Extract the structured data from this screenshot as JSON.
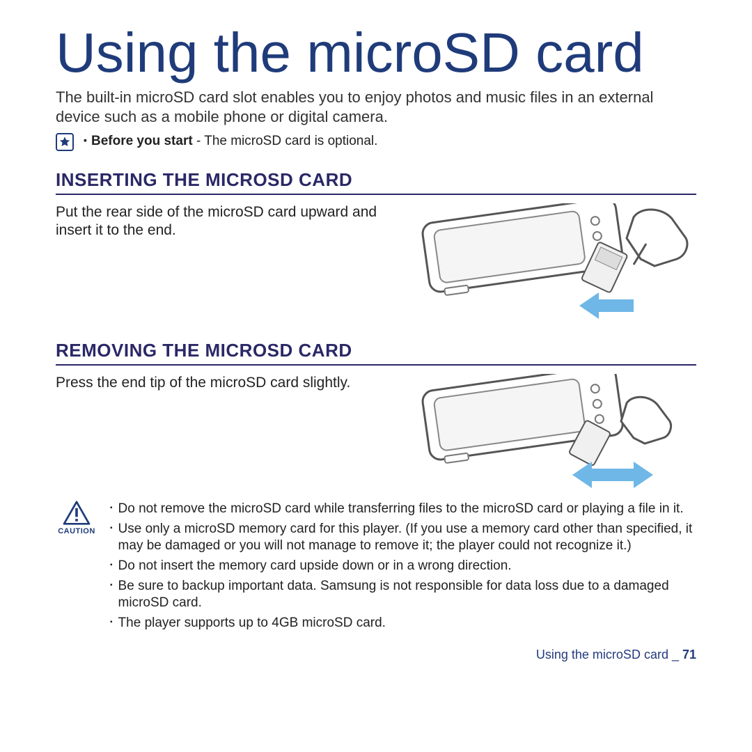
{
  "title": "Using the microSD card",
  "intro": "The built-in microSD card slot enables you to enjoy photos and music files in an external device such as a mobile phone or digital camera.",
  "note": {
    "bold": "Before you start",
    "rest": " - The microSD card is optional."
  },
  "sections": {
    "insert": {
      "heading": "INSERTING THE MICROSD CARD",
      "text": "Put the rear side of the microSD card upward and insert it to the end."
    },
    "remove": {
      "heading": "REMOVING THE MICROSD CARD",
      "text": "Press the end tip of the microSD card slightly."
    }
  },
  "caution": {
    "label": "CAUTION",
    "items": [
      "Do not remove the microSD card while transferring files to the microSD card or playing a file in it.",
      "Use only a microSD memory card for this player. (If you use a memory card other than specified, it may be damaged or you will not manage to remove it; the player could not recognize it.)",
      "Do not insert the memory card upside down or in a wrong direction.",
      "Be sure to backup important data. Samsung is not responsible for data loss due to a damaged microSD card.",
      "The player supports up to 4GB microSD card."
    ]
  },
  "footer": {
    "label": "Using the microSD card _ ",
    "page": "71"
  }
}
